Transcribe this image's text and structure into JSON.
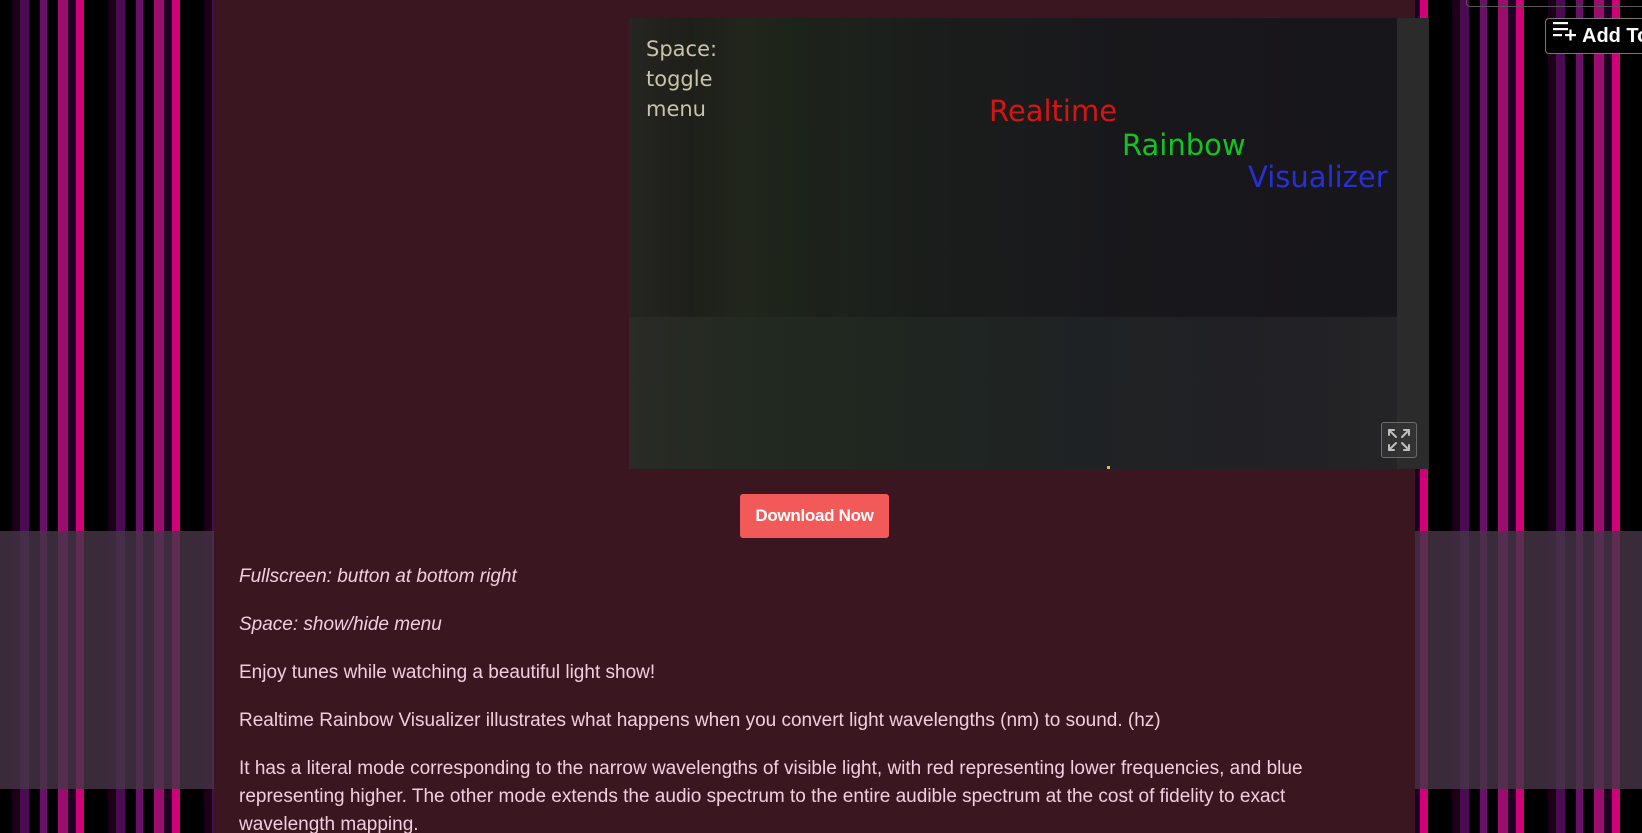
{
  "player": {
    "hint": "Space: toggle menu",
    "title_words": [
      "Realtime",
      "Rainbow",
      "Visualizer"
    ],
    "title_colors": [
      "#d51414",
      "#12c41e",
      "#2630d6"
    ],
    "fullscreen_icon": "expand-arrows-icon"
  },
  "download_button": {
    "label": "Download Now",
    "color": "#f25a59"
  },
  "add_button": {
    "label": "Add To",
    "icon": "playlist-add-icon"
  },
  "description": {
    "line1": "Fullscreen: button at bottom right",
    "line2": "Space: show/hide menu",
    "line3": "Enjoy tunes while watching a beautiful light show!",
    "line4": "Realtime Rainbow Visualizer illustrates what happens when you convert light wavelengths (nm) to sound. (hz)",
    "line5": "It has a literal mode corresponding to the narrow wavelengths of visible light, with red representing lower frequencies, and blue representing higher. The other mode extends the audio spectrum to the entire audible spectrum at the cost of fidelity to exact wavelength mapping."
  },
  "colors": {
    "content_bg": "#3a1620",
    "text": "#f1cde0",
    "stripe_pink": "#d10078",
    "stripe_purple": "#4a0b52"
  }
}
